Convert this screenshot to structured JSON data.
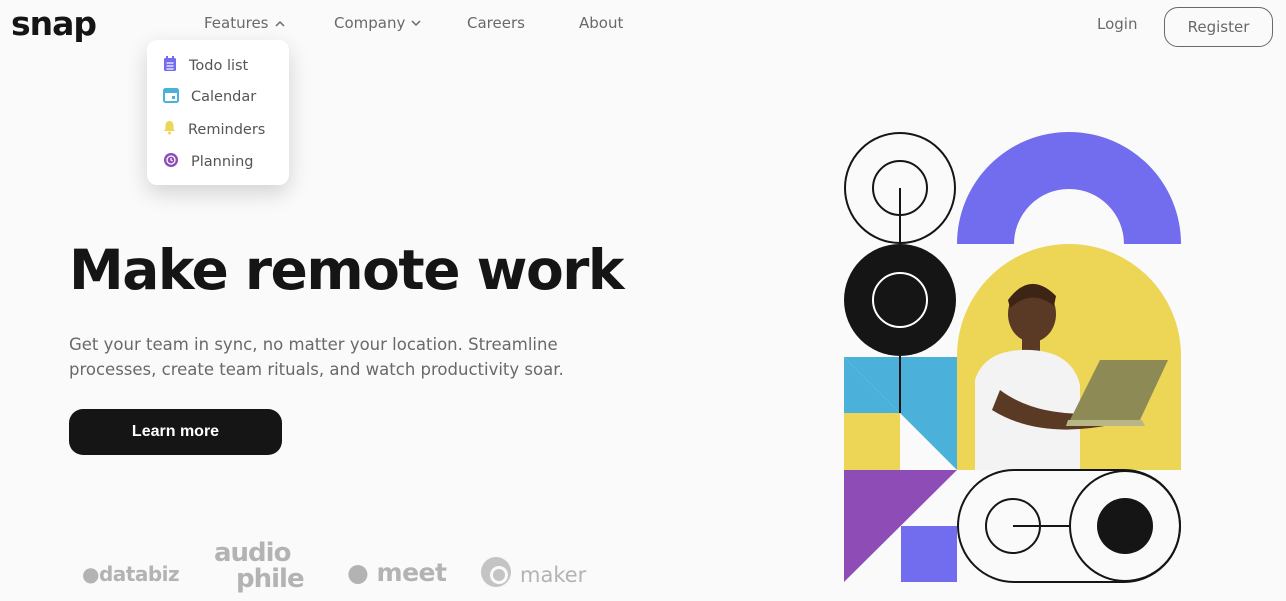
{
  "brand": {
    "logo": "snap"
  },
  "nav": {
    "features": "Features",
    "company": "Company",
    "careers": "Careers",
    "about": "About",
    "features_chevron": "chevron-up-icon",
    "company_chevron": "chevron-down-icon"
  },
  "auth": {
    "login": "Login",
    "register": "Register"
  },
  "features_menu": {
    "items": [
      {
        "label": "Todo list",
        "icon": "todo-list-icon",
        "color": "#726cee"
      },
      {
        "label": "Calendar",
        "icon": "calendar-icon",
        "color": "#4bb1da"
      },
      {
        "label": "Reminders",
        "icon": "bell-icon",
        "color": "#edd556"
      },
      {
        "label": "Planning",
        "icon": "planning-icon",
        "color": "#8e4cb6"
      }
    ]
  },
  "hero": {
    "title": "Make remote work",
    "description": "Get your team in sync, no matter your location. Streamline processes, create team rituals, and watch productivity soar.",
    "cta": "Learn more"
  },
  "clients": {
    "databiz": "●databiz",
    "audiophile_top": "audio",
    "audiophile_bottom": "phile",
    "meet": "● meet",
    "maker": "maker"
  },
  "colors": {
    "text_dark": "#151515",
    "text_gray": "#696969",
    "purple": "#726cee",
    "blue": "#4bb1da",
    "yellow": "#edd556",
    "violet": "#8e4cb6"
  }
}
